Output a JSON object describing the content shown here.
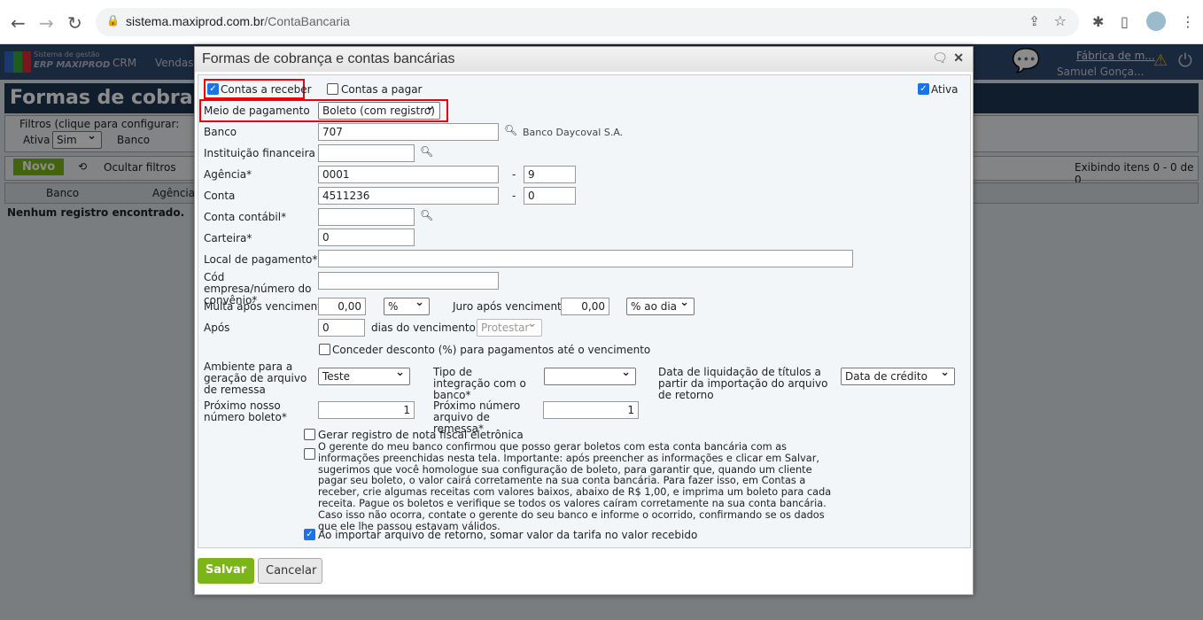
{
  "browser": {
    "url_domain": "sistema.maxiprod.com.br",
    "url_path": "/ContaBancaria"
  },
  "app": {
    "logo_line1": "Sistema de gestão",
    "logo_line2": "ERP MAXIPROD",
    "menu": [
      "CRM",
      "Vendas"
    ],
    "company": "Fábrica de m...",
    "user": "Samuel Gonça...",
    "page_title": "Formas de cobranç",
    "filters_label": "Filtros (clique para configurar:",
    "filter_ativa_label": "Ativa",
    "filter_ativa_value": "Sim",
    "filter_banco_label": "Banco",
    "new_button": "Novo",
    "hide_filters": "Ocultar filtros",
    "paging": "Exibindo itens 0 - 0 de 0",
    "col_banco": "Banco",
    "col_agencia": "Agência",
    "empty": "Nenhum registro encontrado."
  },
  "dialog": {
    "title": "Formas de cobrança e contas bancárias",
    "contas_receber": "Contas a receber",
    "contas_pagar": "Contas a pagar",
    "ativa": "Ativa",
    "meio_label": "Meio de pagamento",
    "meio_value": "Boleto (com registro)",
    "banco_label": "Banco",
    "banco_value": "707",
    "banco_name": "Banco Daycoval S.A.",
    "inst_label": "Instituição financeira",
    "inst_value": "",
    "agencia_label": "Agência*",
    "agencia_value": "0001",
    "agencia_dv": "9",
    "conta_label": "Conta",
    "conta_value": "4511236",
    "conta_dv": "0",
    "dash": "-",
    "contabil_label": "Conta contábil*",
    "contabil_value": "",
    "carteira_label": "Carteira*",
    "carteira_value": "0",
    "local_label": "Local de pagamento*",
    "local_value": "",
    "cod_label": "Cód empresa/número do convênio*",
    "cod_value": "",
    "multa_label": "Multa após vencimento",
    "multa_value": "0,00",
    "multa_unit": "%",
    "juro_label": "Juro após vencimento",
    "juro_value": "0,00",
    "juro_unit": "% ao dia",
    "apos_label": "Após",
    "apos_value": "0",
    "apos_suffix": "dias do vencimento",
    "apos_action": "Protestar",
    "desconto_label": "Conceder desconto (%) para pagamentos até o vencimento",
    "ambiente_label": "Ambiente para a geração de arquivo de remessa",
    "ambiente_value": "Teste",
    "tipo_label": "Tipo de integração com o banco*",
    "tipo_value": "",
    "liq_label": "Data de liquidação de títulos a partir da importação do arquivo de retorno",
    "liq_value": "Data de crédito",
    "prox_boleto_label": "Próximo nosso número boleto*",
    "prox_boleto_value": "1",
    "prox_remessa_label": "Próximo número arquivo de remessa*",
    "prox_remessa_value": "1",
    "nfe_label": "Gerar registro de nota fiscal eletrônica",
    "gerente_label": "O gerente do meu banco confirmou que posso gerar boletos com esta conta bancária com as informações preenchidas nesta tela. Importante: após preencher as informações e clicar em Salvar, sugerimos que você homologue sua configuração de boleto, para garantir que, quando um cliente pagar seu boleto, o valor cairá corretamente na sua conta bancária. Para fazer isso, em Contas a receber, crie algumas receitas com valores baixos, abaixo de R$ 1,00, e imprima um boleto para cada receita. Pague os boletos e verifique se todos os valores caíram corretamente na sua conta bancária. Caso isso não ocorra, contate o gerente do seu banco e informe o ocorrido, confirmando se os dados que ele lhe passou estavam válidos.",
    "tarifa_label": "Ao importar arquivo de retorno, somar valor da tarifa no valor recebido",
    "save": "Salvar",
    "cancel": "Cancelar"
  }
}
